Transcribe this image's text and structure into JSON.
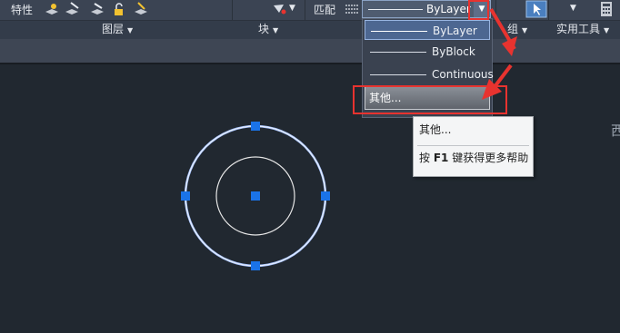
{
  "ribbon": {
    "properties_label": "特性",
    "match_label": "匹配",
    "linetype_value": "ByLayer"
  },
  "panels": {
    "layers": "图层",
    "block": "块",
    "group": "组",
    "utilities": "实用工具"
  },
  "linetype_dropdown": {
    "items": [
      "ByLayer",
      "ByBlock",
      "Continuous"
    ],
    "selected": "ByLayer",
    "other_label": "其他..."
  },
  "tooltip": {
    "title": "其他...",
    "help_prefix": "按",
    "help_key": "F1",
    "help_suffix": "键获得更多帮助"
  },
  "canvas": {
    "corner_char": "西"
  },
  "colors": {
    "canvas_bg": "#212830",
    "ribbon_bg": "#3b4453",
    "highlight_red": "#e8332f",
    "grip_blue": "#1a73e8",
    "selected_circle": "#a8c4ff",
    "circle_white": "#e6e6e6"
  }
}
